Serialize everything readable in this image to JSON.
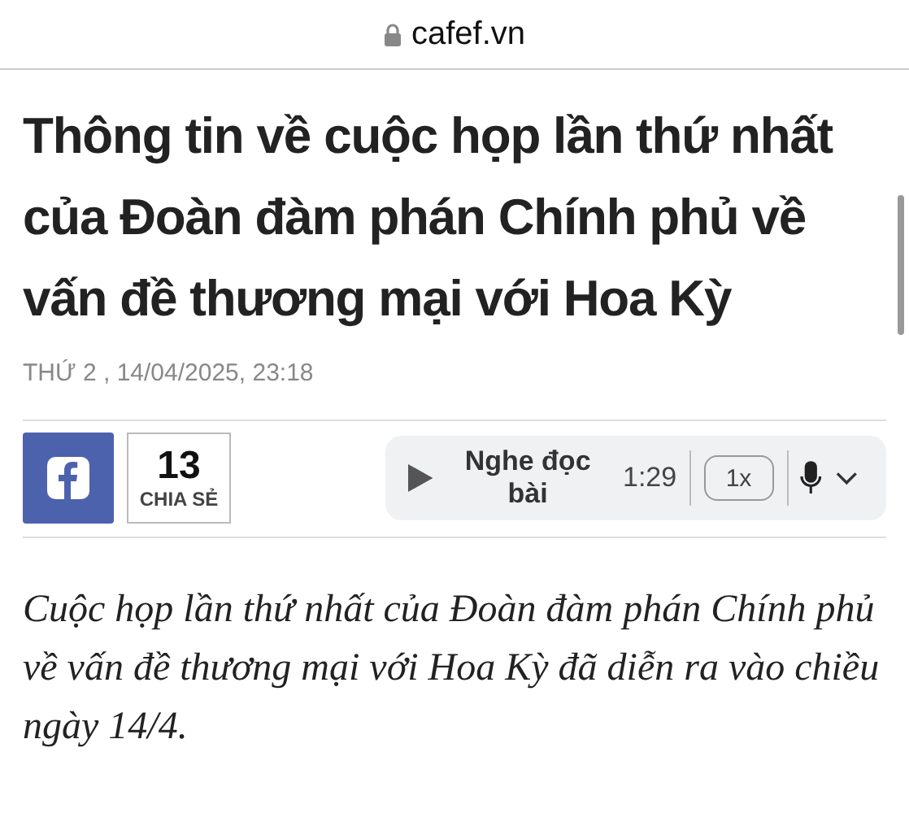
{
  "address_bar": {
    "url": "cafef.vn"
  },
  "article": {
    "title": "Thông tin về cuộc họp lần thứ nhất của Đoàn đàm phán Chính phủ về vấn đề thương mại với Hoa Kỳ",
    "date": "THỨ 2 , 14/04/2025, 23:18",
    "share": {
      "count": "13",
      "label": "CHIA SẺ"
    },
    "audio": {
      "label": "Nghe đọc bài",
      "duration": "1:29",
      "speed": "1x"
    },
    "lead": "Cuộc họp lần thứ nhất của Đoàn đàm phán Chính phủ về vấn đề thương mại với Hoa Kỳ đã diễn ra vào chiều ngày 14/4."
  }
}
